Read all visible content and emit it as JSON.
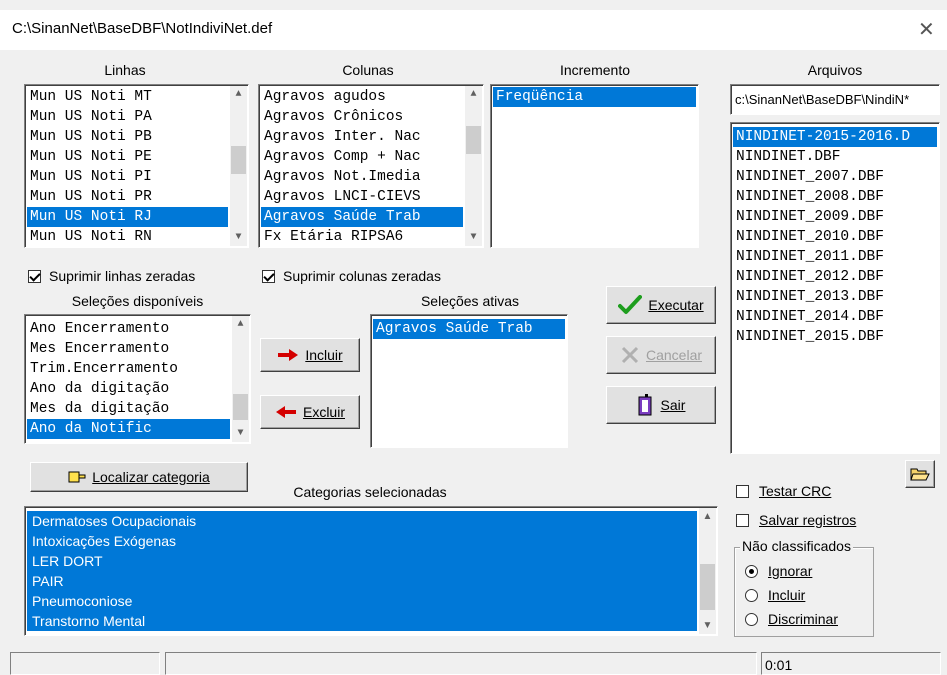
{
  "window": {
    "title": "C:\\SinanNet\\BaseDBF\\NotIndiviNet.def",
    "close_glyph": "✕"
  },
  "linhas": {
    "label": "Linhas",
    "items": [
      "Mun US Noti MT",
      "Mun US Noti PA",
      "Mun US Noti PB",
      "Mun US Noti PE",
      "Mun US Noti PI",
      "Mun US Noti PR",
      "Mun US Noti RJ",
      "Mun US Noti RN"
    ],
    "selected": "Mun US Noti RJ"
  },
  "colunas": {
    "label": "Colunas",
    "items": [
      "Agravos agudos",
      "Agravos Crônicos",
      "Agravos Inter. Nac",
      "Agravos Comp + Nac",
      "Agravos Not.Imedia",
      "Agravos LNCI-CIEVS",
      "Agravos Saúde Trab",
      "Fx Etária RIPSA6"
    ],
    "selected": "Agravos Saúde Trab"
  },
  "incremento": {
    "label": "Incremento",
    "items": [
      "Freqüência"
    ]
  },
  "arquivos": {
    "label": "Arquivos",
    "path": "c:\\SinanNet\\BaseDBF\\NindiN*",
    "items": [
      "NINDINET-2015-2016.D",
      "NINDINET.DBF",
      "NINDINET_2007.DBF",
      "NINDINET_2008.DBF",
      "NINDINET_2009.DBF",
      "NINDINET_2010.DBF",
      "NINDINET_2011.DBF",
      "NINDINET_2012.DBF",
      "NINDINET_2013.DBF",
      "NINDINET_2014.DBF",
      "NINDINET_2015.DBF"
    ],
    "selected": "NINDINET-2015-2016.D"
  },
  "checks": {
    "suprimir_linhas": {
      "label": "Suprimir linhas zeradas",
      "checked": true
    },
    "suprimir_colunas": {
      "label": "Suprimir colunas zeradas",
      "checked": true
    },
    "testar_crc": {
      "label": "Testar CRC",
      "checked": false
    },
    "salvar_registros": {
      "label": "Salvar registros",
      "checked": false
    }
  },
  "selecoes_disponiveis": {
    "label": "Seleções disponíveis",
    "items": [
      "Ano Encerramento",
      "Mes Encerramento",
      "Trim.Encerramento",
      "Ano da digitação",
      "Mes da digitação",
      "Ano da Notific"
    ],
    "selected": "Ano da Notific"
  },
  "selecoes_ativas": {
    "label": "Seleções ativas",
    "items": [
      "Agravos Saúde Trab"
    ]
  },
  "buttons": {
    "incluir": "Incluir",
    "excluir": "Excluir",
    "executar": "Executar",
    "cancelar": "Cancelar",
    "sair": "Sair",
    "localizar": "Localizar categoria"
  },
  "categorias": {
    "label": "Categorias selecionadas",
    "items": [
      "Dermatoses Ocupacionais",
      "Intoxicações Exógenas",
      "LER DORT",
      "PAIR",
      "Pneumoconiose",
      "Transtorno Mental"
    ]
  },
  "nao_classificados": {
    "label": "Não classificados",
    "options": [
      "Ignorar",
      "Incluir",
      "Discriminar"
    ],
    "selected": "Ignorar"
  },
  "status": {
    "time": "0:01"
  },
  "colors": {
    "selection": "#0078d7",
    "check_green": "#1e9e1e",
    "arrow_red": "#d40000"
  }
}
